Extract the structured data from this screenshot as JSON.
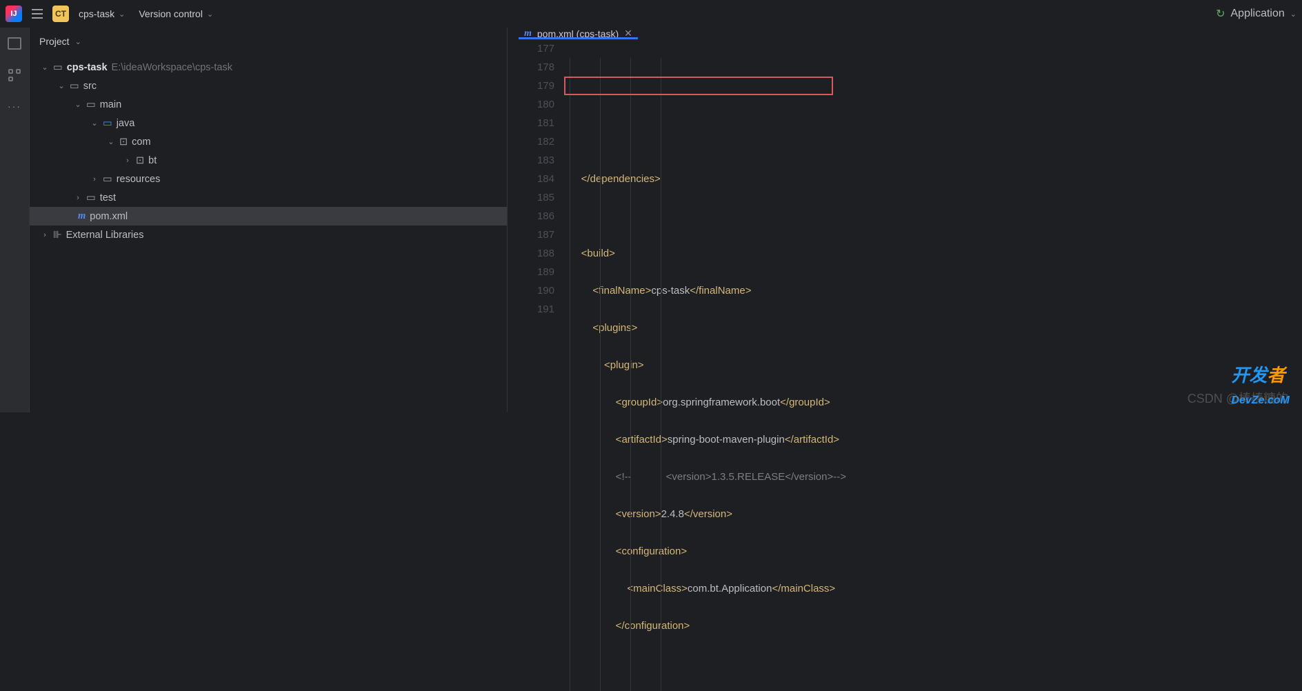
{
  "toolbar": {
    "ct_badge": "CT",
    "project_name": "cps-task",
    "vcs_label": "Version control",
    "run_config": "Application"
  },
  "project_panel": {
    "title": "Project",
    "tree": {
      "root": {
        "name": "cps-task",
        "path": "E:\\ideaWorkspace\\cps-task"
      },
      "src": "src",
      "main": "main",
      "java": "java",
      "com": "com",
      "bt": "bt",
      "resources": "resources",
      "test": "test",
      "pom": "pom.xml",
      "ext_lib": "External Libraries"
    }
  },
  "editor": {
    "tab_label": "pom.xml (cps-task)",
    "lines": {
      "n177": "177",
      "n178": "178",
      "n179": "179",
      "n180": "180",
      "n181": "181",
      "n182": "182",
      "n183": "183",
      "n184": "184",
      "n185": "185",
      "n186": "186",
      "n187": "187",
      "n188": "188",
      "n189": "189",
      "n190": "190",
      "n191": "191"
    },
    "code": {
      "l179": "    </dependencies>",
      "l181_open": "    <build>",
      "l182": "        <finalName>cps-task</finalName>",
      "l183": "        <plugins>",
      "l184": "            <plugin>",
      "l185_a": "                <groupId>",
      "l185_b": "org.springframework.boot",
      "l185_c": "</groupId>",
      "l186_a": "                <artifactId>",
      "l186_b": "spring-boot-maven-plugin",
      "l186_c": "</artifactId>",
      "l187": "                <!--            <version>1.3.5.RELEASE</version>-->",
      "l188_a": "                <version>",
      "l188_b": "2.4.8",
      "l188_c": "</version>",
      "l189": "                <configuration>",
      "l190_a": "                    <mainClass>",
      "l190_b": "com.bt.Application",
      "l190_c": "</mainClass>",
      "l191": "                </configuration>"
    }
  },
  "watermark": {
    "csdn": "CSDN @棒棒糖的",
    "devze_a": "开发",
    "devze_b": "者",
    "devze_c": "DevZe.coM"
  }
}
